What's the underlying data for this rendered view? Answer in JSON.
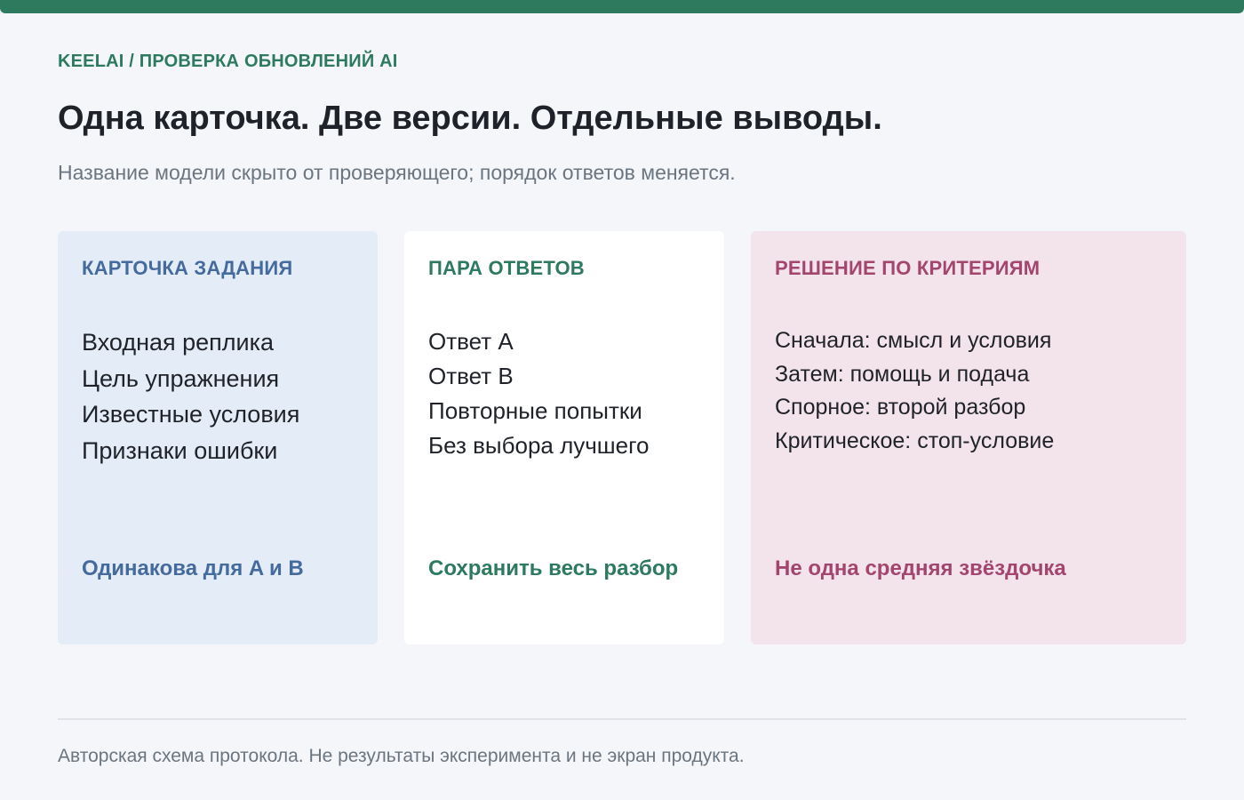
{
  "header": {
    "eyebrow": "KEELAI / ПРОВЕРКА ОБНОВЛЕНИЙ AI",
    "title": "Одна карточка. Две версии. Отдельные выводы.",
    "subtitle": "Название модели скрыто от проверяющего; порядок ответов меняется."
  },
  "cards": {
    "task": {
      "heading": "КАРТОЧКА ЗАДАНИЯ",
      "items": [
        "Входная реплика",
        "Цель упражнения",
        "Известные условия",
        "Признаки ошибки"
      ],
      "footer": "Одинакова для A и B",
      "accent": "#456a9e",
      "background": "#e4ecf7"
    },
    "pair": {
      "heading": "ПАРА ОТВЕТОВ",
      "items": [
        "Ответ A",
        "Ответ B",
        "Повторные попытки",
        "Без выбора лучшего"
      ],
      "footer": "Сохранить весь разбор",
      "accent": "#2d7a5f",
      "background": "#ffffff"
    },
    "decision": {
      "heading": "РЕШЕНИЕ ПО КРИТЕРИЯМ",
      "items": [
        "Сначала: смысл и условия",
        "Затем: помощь и подача",
        "Спорное: второй разбор",
        "Критическое: стоп-условие"
      ],
      "footer": "Не одна средняя звёздочка",
      "accent": "#a2466e",
      "background": "#f3e3ea"
    }
  },
  "footnote": "Авторская схема протокола. Не результаты эксперимента и не экран продукта.",
  "colors": {
    "top_bar": "#2d7a5f",
    "page_background": "#f4f6f9"
  }
}
